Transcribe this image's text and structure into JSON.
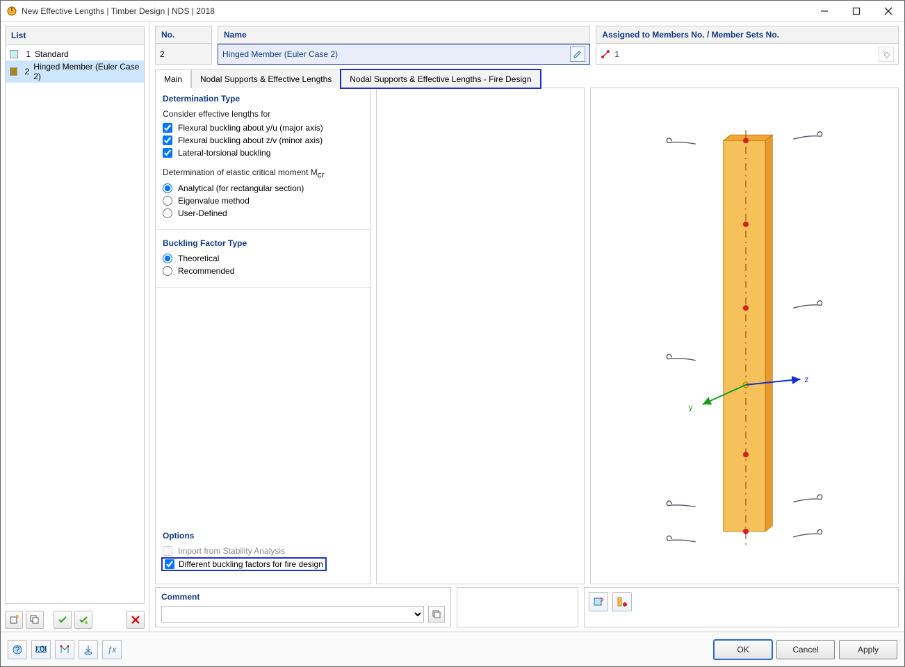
{
  "title": "New Effective Lengths | Timber Design | NDS | 2018",
  "list": {
    "header": "List",
    "items": [
      {
        "num": "1",
        "label": "Standard",
        "color": "#c9f0f5"
      },
      {
        "num": "2",
        "label": "Hinged Member (Euler Case 2)",
        "color": "#a78a1f"
      }
    ]
  },
  "header": {
    "no_label": "No.",
    "no_value": "2",
    "name_label": "Name",
    "name_value": "Hinged Member (Euler Case 2)",
    "assigned_label": "Assigned to Members No. / Member Sets No.",
    "assigned_value": "1"
  },
  "tabs": [
    {
      "label": "Main",
      "active": true
    },
    {
      "label": "Nodal Supports & Effective Lengths",
      "active": false
    },
    {
      "label": "Nodal Supports & Effective Lengths - Fire Design",
      "active": false,
      "highlight": true
    }
  ],
  "determination": {
    "title": "Determination Type",
    "consider_label": "Consider effective lengths for",
    "flex_y": "Flexural buckling about y/u (major axis)",
    "flex_z": "Flexural buckling about z/v (minor axis)",
    "ltb": "Lateral-torsional buckling",
    "mcr_label": "Determination of elastic critical moment M",
    "mcr_sub": "cr",
    "opt_analytical": "Analytical (for rectangular section)",
    "opt_eigen": "Eigenvalue method",
    "opt_userdef": "User-Defined"
  },
  "buckling": {
    "title": "Buckling Factor Type",
    "theoretical": "Theoretical",
    "recommended": "Recommended"
  },
  "options": {
    "title": "Options",
    "import": "Import from Stability Analysis",
    "diff_fire": "Different buckling factors for fire design"
  },
  "comment_label": "Comment",
  "buttons": {
    "ok": "OK",
    "cancel": "Cancel",
    "apply": "Apply"
  },
  "axis": {
    "y": "y",
    "z": "z"
  }
}
